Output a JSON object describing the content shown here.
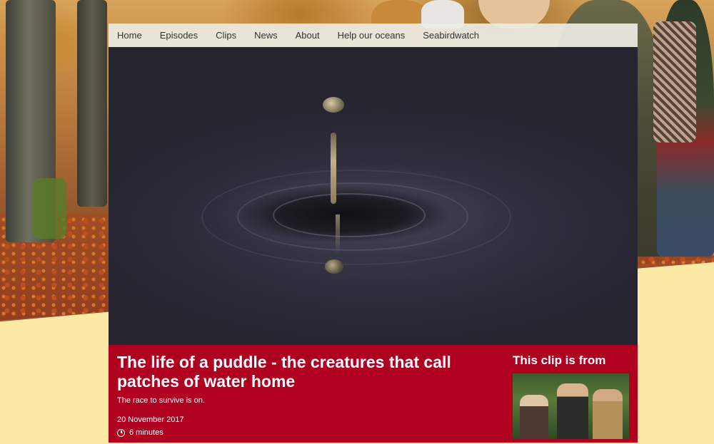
{
  "nav": {
    "items": [
      {
        "label": "Home"
      },
      {
        "label": "Episodes"
      },
      {
        "label": "Clips"
      },
      {
        "label": "News"
      },
      {
        "label": "About"
      },
      {
        "label": "Help our oceans"
      },
      {
        "label": "Seabirdwatch"
      }
    ]
  },
  "clip": {
    "title": "The life of a puddle - the creatures that call patches of water home",
    "tagline": "The race to survive is on.",
    "date": "20 November 2017",
    "duration": "6 minutes"
  },
  "sidebar": {
    "heading": "This clip is from"
  },
  "colors": {
    "brand_red": "#b00020",
    "nav_bg": "#ebebe5",
    "page_bg": "#fde9a6"
  }
}
